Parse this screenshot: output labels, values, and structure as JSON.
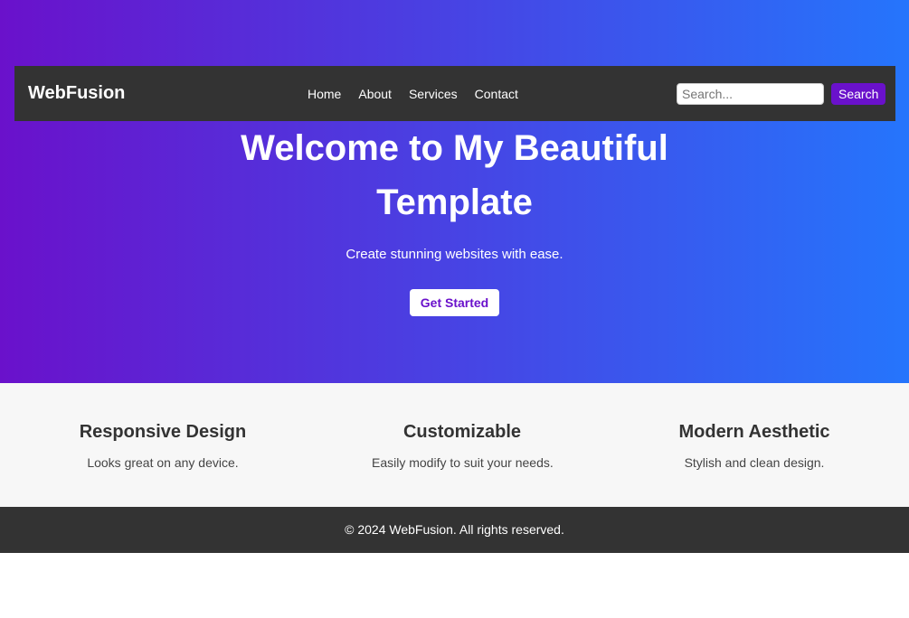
{
  "navbar": {
    "brand": "WebFusion",
    "links": [
      "Home",
      "About",
      "Services",
      "Contact"
    ],
    "search": {
      "placeholder": "Search...",
      "value": "",
      "button_label": "Search"
    }
  },
  "hero": {
    "title_line1": "Welcome to My Beautiful",
    "title_line2": "Template",
    "subtitle": "Create stunning websites with ease.",
    "cta_label": "Get Started"
  },
  "features": [
    {
      "title": "Responsive Design",
      "description": "Looks great on any device."
    },
    {
      "title": "Customizable",
      "description": "Easily modify to suit your needs."
    },
    {
      "title": "Modern Aesthetic",
      "description": "Stylish and clean design."
    }
  ],
  "footer": {
    "text": "© 2024 WebFusion. All rights reserved."
  },
  "colors": {
    "gradient_start": "#6a11cb",
    "gradient_end": "#2575fc",
    "nav_background": "#333333",
    "accent": "#6a11cb",
    "features_background": "#f7f7f7"
  }
}
